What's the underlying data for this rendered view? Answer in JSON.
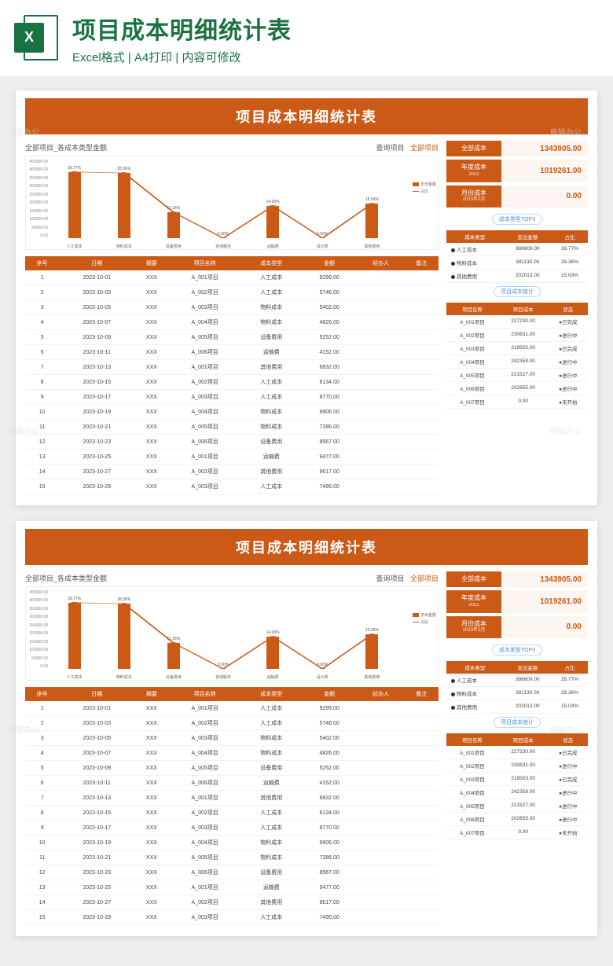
{
  "banner": {
    "main_title": "项目成本明细统计表",
    "sub_title": "Excel格式 | A4打印 | 内容可修改",
    "logo_letter": "X"
  },
  "sheet": {
    "title": "项目成本明细统计表",
    "chart_title": "全部项目_各成本类型金额",
    "filter_label": "查询项目",
    "filter_value": "全部项目",
    "legend_bar": "支出金额",
    "legend_line": "占比"
  },
  "chart_data": {
    "type": "bar",
    "categories": [
      "人工成本",
      "物料成本",
      "设备费用",
      "咨询服务",
      "运输费",
      "设计费",
      "其他费用"
    ],
    "values": [
      386609,
      381130,
      151186,
      0,
      188013,
      0,
      202013
    ],
    "percents": [
      "28.77%",
      "28.36%",
      "11.18%",
      "0.00%",
      "14.00%",
      "0.00%",
      "15.03%"
    ],
    "ylabel": "",
    "ylim": [
      0,
      450000
    ],
    "yticks": [
      "450000.00",
      "400000.00",
      "350000.00",
      "300000.00",
      "250000.00",
      "200000.00",
      "150000.00",
      "100000.00",
      "50000.00",
      "0.00"
    ]
  },
  "main_table": {
    "headers": [
      "序号",
      "日期",
      "摘要",
      "项目名称",
      "成本类型",
      "金额",
      "经办人",
      "备注"
    ],
    "rows": [
      [
        "1",
        "2023-10-01",
        "XXX",
        "A_001项目",
        "人工成本",
        "9299.00",
        "",
        ""
      ],
      [
        "2",
        "2023-10-03",
        "XXX",
        "A_002项目",
        "人工成本",
        "5746.00",
        "",
        ""
      ],
      [
        "3",
        "2023-10-05",
        "XXX",
        "A_003项目",
        "物料成本",
        "5402.00",
        "",
        ""
      ],
      [
        "4",
        "2023-10-07",
        "XXX",
        "A_004项目",
        "物料成本",
        "4826.00",
        "",
        ""
      ],
      [
        "5",
        "2023-10-09",
        "XXX",
        "A_005项目",
        "设备费用",
        "5252.00",
        "",
        ""
      ],
      [
        "6",
        "2023-10-11",
        "XXX",
        "A_006项目",
        "运输费",
        "4152.00",
        "",
        ""
      ],
      [
        "7",
        "2023-10-13",
        "XXX",
        "A_001项目",
        "其他费用",
        "6832.00",
        "",
        ""
      ],
      [
        "8",
        "2023-10-15",
        "XXX",
        "A_002项目",
        "人工成本",
        "6134.00",
        "",
        ""
      ],
      [
        "9",
        "2023-10-17",
        "XXX",
        "A_003项目",
        "人工成本",
        "8770.00",
        "",
        ""
      ],
      [
        "10",
        "2023-10-19",
        "XXX",
        "A_004项目",
        "物料成本",
        "9906.00",
        "",
        ""
      ],
      [
        "11",
        "2023-10-21",
        "XXX",
        "A_005项目",
        "物料成本",
        "7286.00",
        "",
        ""
      ],
      [
        "12",
        "2023-10-23",
        "XXX",
        "A_006项目",
        "设备费用",
        "8567.00",
        "",
        ""
      ],
      [
        "13",
        "2023-10-25",
        "XXX",
        "A_001项目",
        "运输费",
        "9477.00",
        "",
        ""
      ],
      [
        "14",
        "2023-10-27",
        "XXX",
        "A_002项目",
        "其他费用",
        "9617.00",
        "",
        ""
      ],
      [
        "15",
        "2023-10-29",
        "XXX",
        "A_003项目",
        "人工成本",
        "7495.00",
        "",
        ""
      ]
    ]
  },
  "stats": [
    {
      "label": "全部成本",
      "sub": "",
      "value": "1343905.00"
    },
    {
      "label": "年度成本",
      "sub": "2022",
      "value": "1019261.00"
    },
    {
      "label": "月份成本",
      "sub": "2023年2月",
      "value": "0.00"
    }
  ],
  "top3": {
    "pill": "成本类型TOP3",
    "headers": [
      "成本类型",
      "支出金额",
      "占比"
    ],
    "rows": [
      {
        "dot": "#333",
        "c0": "人工成本",
        "c1": "386609.00",
        "c2": "28.77%"
      },
      {
        "dot": "#333",
        "c0": "物料成本",
        "c1": "381130.00",
        "c2": "28.36%"
      },
      {
        "dot": "#333",
        "c0": "其他费用",
        "c1": "202013.00",
        "c2": "15.03%"
      }
    ]
  },
  "proj_stats": {
    "pill": "项目成本统计",
    "headers": [
      "项目名称",
      "项目成本",
      "状态"
    ],
    "rows": [
      {
        "c0": "A_001项目",
        "c1": "227230.00",
        "c2": "已完成",
        "cls": "st-done"
      },
      {
        "c0": "A_002项目",
        "c1": "230631.00",
        "c2": "进行中",
        "cls": "st-prog"
      },
      {
        "c0": "A_003项目",
        "c1": "219503.00",
        "c2": "已完成",
        "cls": "st-done"
      },
      {
        "c0": "A_004项目",
        "c1": "242359.00",
        "c2": "进行中",
        "cls": "st-prog"
      },
      {
        "c0": "A_005项目",
        "c1": "221527.00",
        "c2": "进行中",
        "cls": "st-prog"
      },
      {
        "c0": "A_006项目",
        "c1": "202655.00",
        "c2": "进行中",
        "cls": "st-prog"
      },
      {
        "c0": "A_007项目",
        "c1": "0.00",
        "c2": "未开始",
        "cls": "st-not"
      }
    ]
  },
  "watermark": "熊猫办公"
}
